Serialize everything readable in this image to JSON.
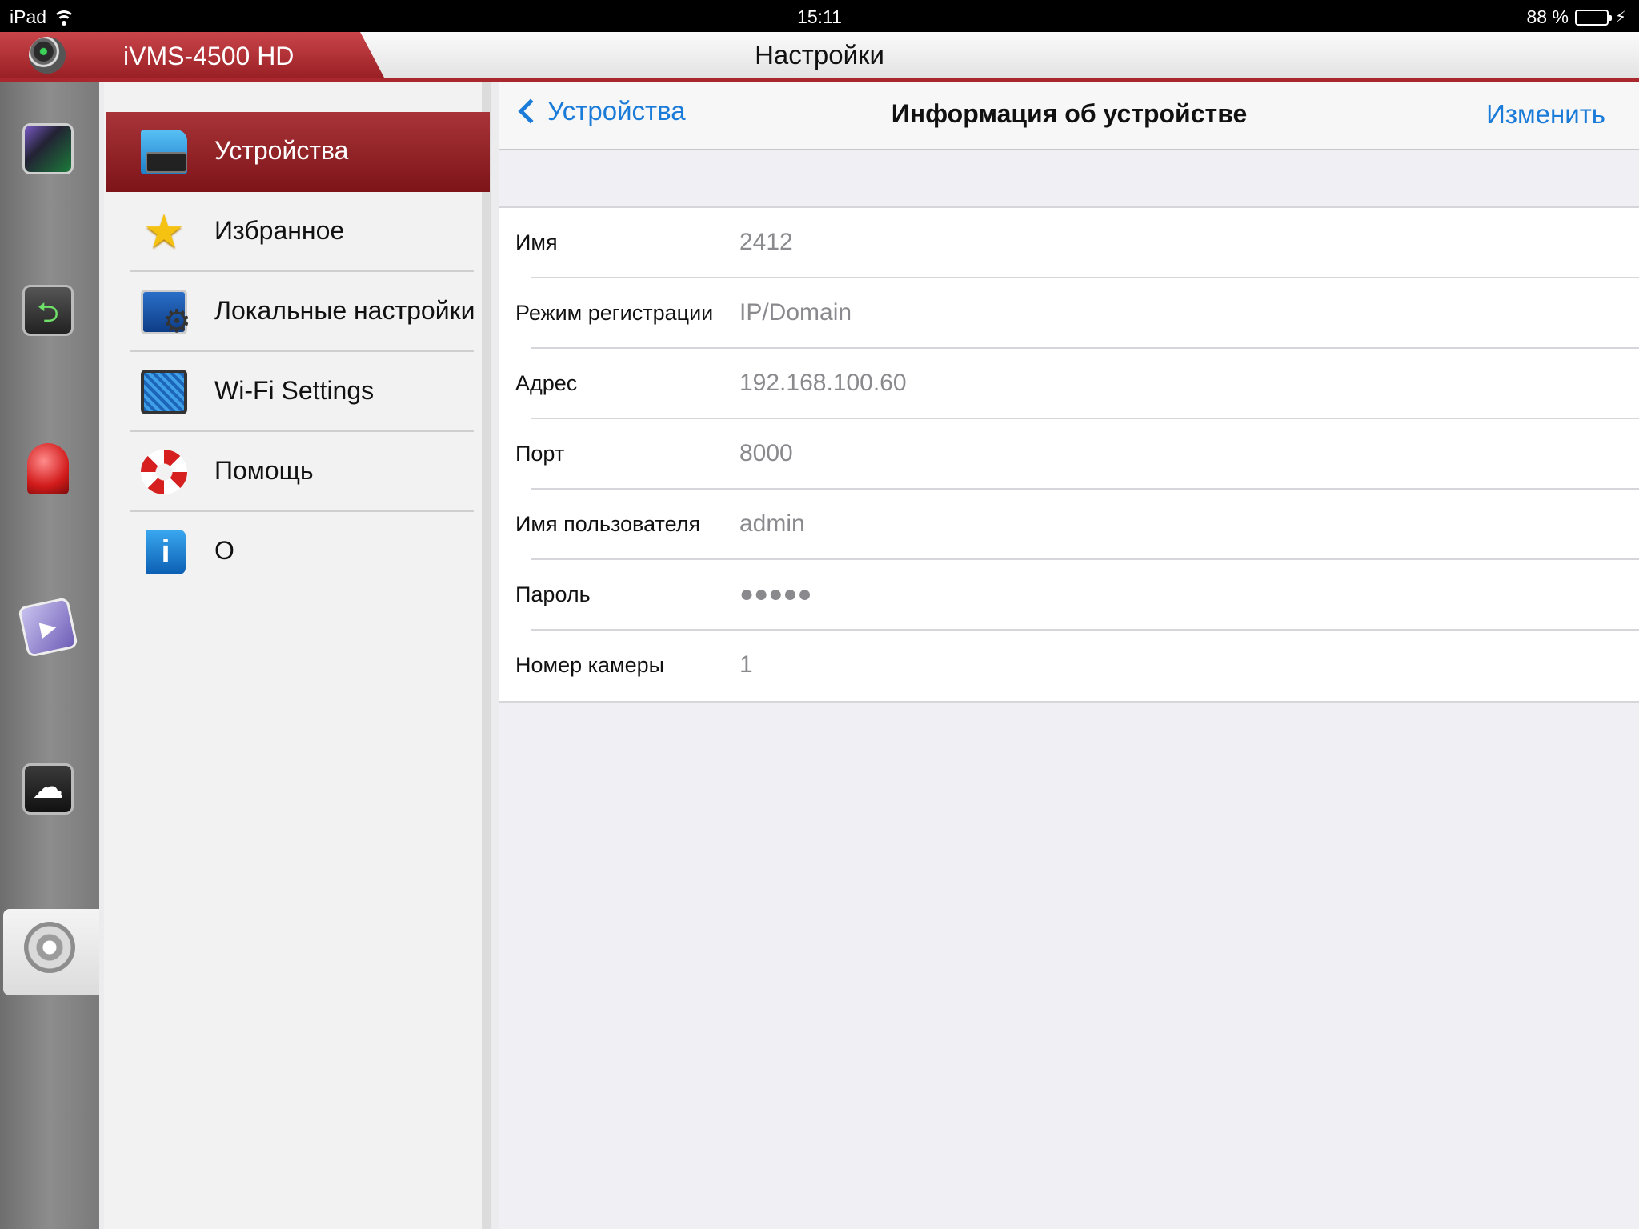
{
  "status_bar": {
    "device": "iPad",
    "time": "15:11",
    "battery": "88 %",
    "battery_level": 0.88
  },
  "app": {
    "brand": "iVMS-4500 HD",
    "title": "Настройки"
  },
  "menu": {
    "items": [
      {
        "label": "Устройства",
        "icon": "devices-folder-icon",
        "selected": true
      },
      {
        "label": "Избранное",
        "icon": "star-icon",
        "selected": false
      },
      {
        "label": "Локальные настройки",
        "icon": "local-settings-icon",
        "selected": false
      },
      {
        "label": "Wi-Fi Settings",
        "icon": "wifi-settings-icon",
        "selected": false
      },
      {
        "label": "Помощь",
        "icon": "lifebuoy-icon",
        "selected": false
      },
      {
        "label": "О",
        "icon": "info-book-icon",
        "selected": false
      }
    ]
  },
  "detail": {
    "back_label": "Устройства",
    "title": "Информация об устройстве",
    "edit_label": "Изменить",
    "rows": [
      {
        "label": "Имя",
        "value": "2412"
      },
      {
        "label": "Режим регистрации",
        "value": "IP/Domain"
      },
      {
        "label": "Адрес",
        "value": "192.168.100.60"
      },
      {
        "label": "Порт",
        "value": "8000"
      },
      {
        "label": "Имя пользователя",
        "value": "admin"
      },
      {
        "label": "Пароль",
        "value": "●●●●●"
      },
      {
        "label": "Номер камеры",
        "value": "1"
      }
    ]
  },
  "colors": {
    "accent": "#1a7bd8",
    "brand_red": "#a8282d",
    "battery": "#4cd964"
  }
}
